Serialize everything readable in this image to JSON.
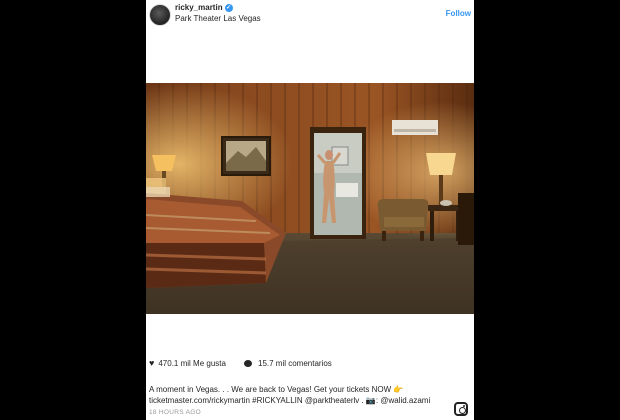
{
  "post": {
    "username": "ricky_martin",
    "location": "Park Theater Las Vegas",
    "follow_label": "Follow",
    "likes": "470.1 mil Me gusta",
    "comments": "15.7 mil comentarios",
    "caption": "A moment in Vegas. . . We are back to Vegas! Get your tickets NOW 👉 ticketmaster.com/rickymartin #RICKYALLIN @parktheaterlv . 📷: @walid.azami",
    "timestamp": "18 HOURS AGO"
  },
  "icons": {
    "verified": "verified-badge-icon",
    "like": "heart-icon",
    "comment": "comment-bubble-icon",
    "brand": "instagram-icon"
  },
  "colors": {
    "link": "#3897f0",
    "text": "#262626",
    "muted": "#999999",
    "background": "#000000"
  }
}
